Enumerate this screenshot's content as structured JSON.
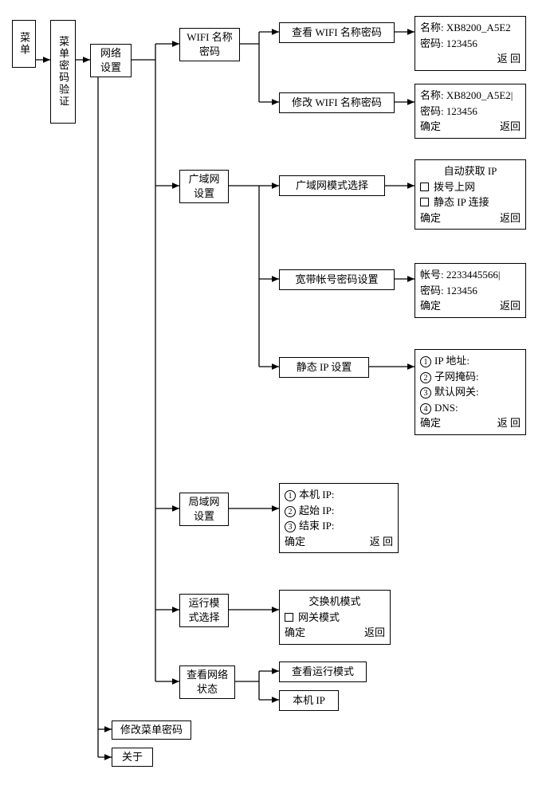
{
  "col0": {
    "menu": "菜单",
    "menu_pw_verify": "菜单密码验证"
  },
  "col1": {
    "network_settings": "网络设置",
    "change_menu_pw": "修改菜单密码",
    "about": "关于"
  },
  "col2": {
    "wifi_name_pw": "WIFI 名称密码",
    "wan_settings": "广域网设置",
    "lan_settings": "局域网设置",
    "run_mode_select": "运行模式选择",
    "view_net_status": "查看网络状态"
  },
  "col3": {
    "view_wifi_name_pw": "查看 WIFI 名称密码",
    "modify_wifi_name_pw": "修改 WIFI 名称密码",
    "wan_mode_select": "广域网模式选择",
    "broadband_acct_pw": "宽带帐号密码设置",
    "static_ip_settings": "静态 IP 设置",
    "view_run_mode": "查看运行模式",
    "local_ip": "本机 IP"
  },
  "panels": {
    "wifi_view": {
      "name_label": "名称:",
      "name_val": "XB8200_A5E2",
      "pw_label": "密码:",
      "pw_val": "123456",
      "back": "返  回"
    },
    "wifi_edit": {
      "name_label": "名称:",
      "name_val": "XB8200_A5E2|",
      "pw_label": "密码:",
      "pw_val": "123456",
      "ok": "确定",
      "back": "返回"
    },
    "wan_mode": {
      "opt1": "自动获取 IP",
      "opt2": "拨号上网",
      "opt3": "静态 IP 连接",
      "ok": "确定",
      "back": "返回"
    },
    "broadband": {
      "acct_label": "帐号:",
      "acct_val": "2233445566|",
      "pw_label": "密码:",
      "pw_val": "123456",
      "ok": "确定",
      "back": "返回"
    },
    "static_ip": {
      "l1": "IP 地址:",
      "l2": "子网掩码:",
      "l3": "默认网关:",
      "l4": "DNS:",
      "ok": "确定",
      "back": "返  回"
    },
    "lan": {
      "l1": "本机 IP:",
      "l2": "起始 IP:",
      "l3": "结束 IP:",
      "ok": "确定",
      "back": "返  回"
    },
    "run_mode": {
      "opt1": "交换机模式",
      "opt2": "网关模式",
      "ok": "确定",
      "back": "返回"
    }
  },
  "n": {
    "1": "1",
    "2": "2",
    "3": "3",
    "4": "4"
  }
}
